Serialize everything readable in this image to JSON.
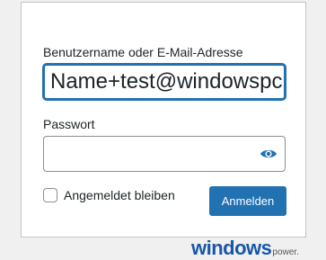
{
  "login": {
    "username_label": "Benutzername oder E-Mail-Adresse",
    "username_value": "Name+test@windowspc",
    "password_label": "Passwort",
    "password_value": "",
    "remember_label": "Angemeldet bleiben",
    "remember_checked": false,
    "submit_label": "Anmelden"
  },
  "icons": {
    "password_toggle": "eye-icon"
  },
  "watermark": {
    "main": "windows",
    "sub": "power."
  },
  "colors": {
    "accent": "#2271b1",
    "page_background": "#f0f0f1",
    "card_border": "#c3c4c7",
    "input_border": "#8c8f94",
    "text": "#1d2327",
    "watermark_blue": "#1a56a8"
  }
}
